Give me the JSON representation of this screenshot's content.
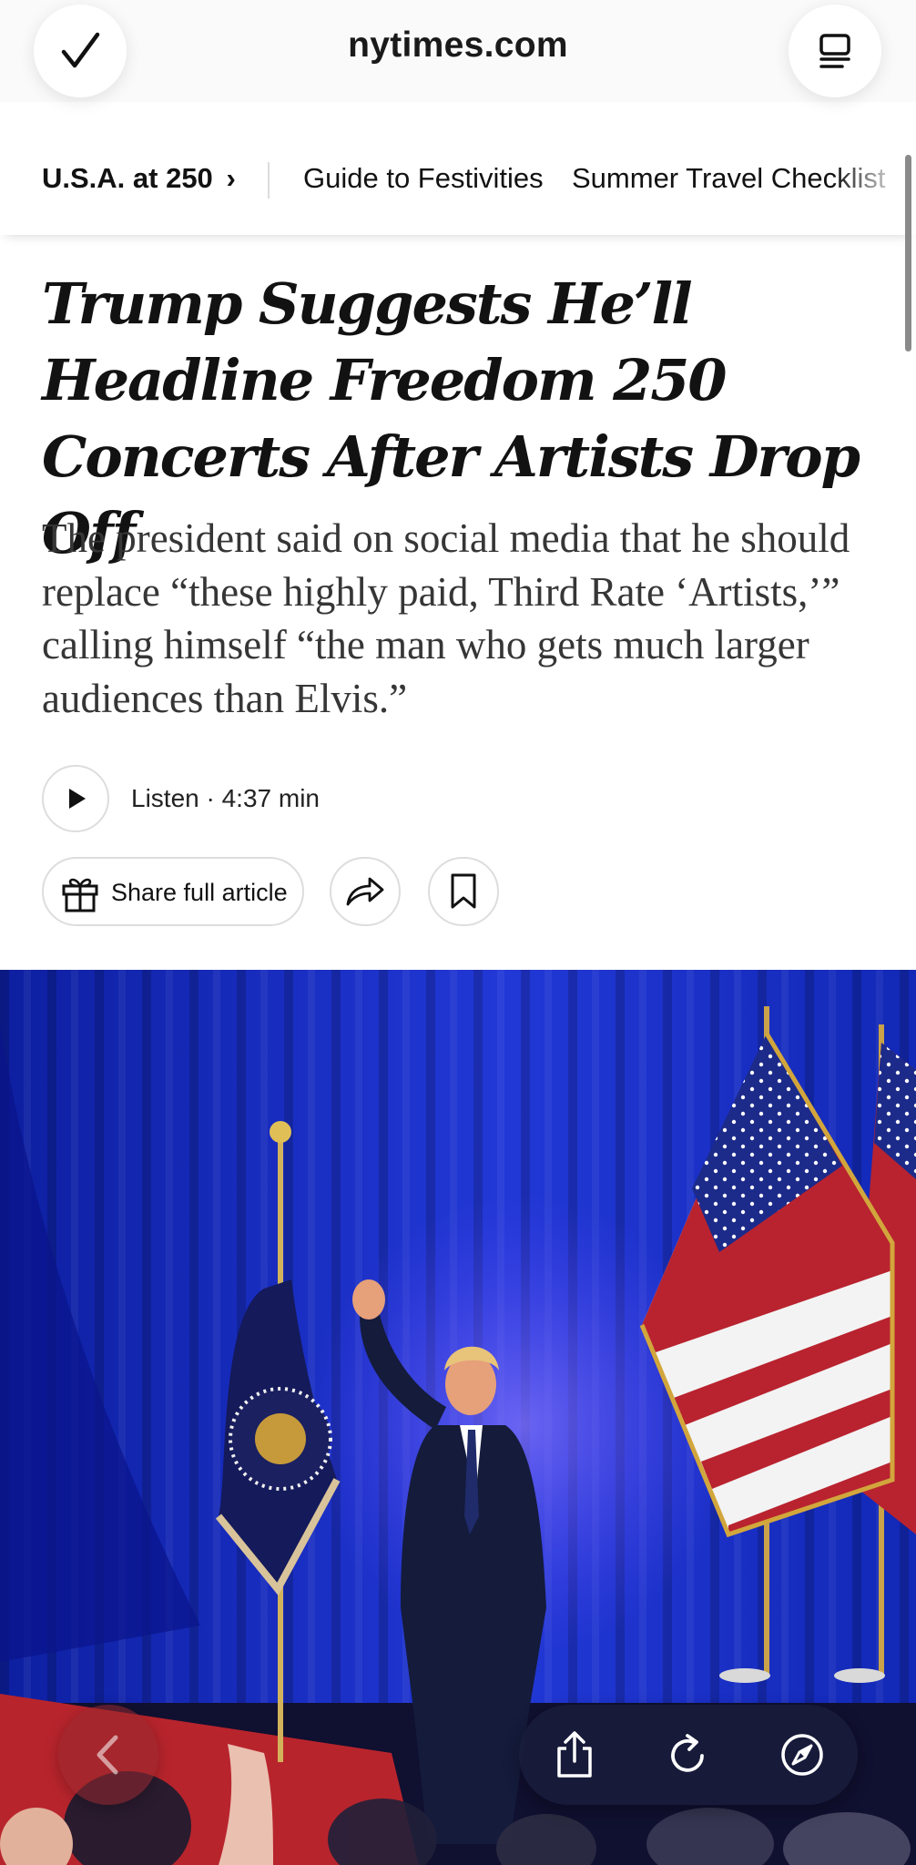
{
  "browser": {
    "url": "nytimes.com"
  },
  "section_nav": {
    "current": "U.S.A. at 250",
    "current_chevron": "›",
    "links": [
      "Guide to Festivities",
      "Summer Travel Checklist"
    ]
  },
  "article": {
    "headline": "Trump Suggests He’ll Headline Freedom 250 Concerts After Artists Drop Off",
    "summary": "The president said on social media that he should replace “these highly paid, Third Rate ‘Artists,’” calling himself “the man who gets much larger audiences than Elvis.”",
    "listen_label": "Listen · 4:37 min",
    "share_label": "Share full article"
  },
  "icons": {
    "done": "checkmark-icon",
    "reader": "reader-mode-icon",
    "play": "play-icon",
    "gift": "gift-icon",
    "share_arrow": "share-arrow-icon",
    "bookmark": "bookmark-icon",
    "back": "chevron-left-icon",
    "share_sheet": "share-sheet-icon",
    "reload": "reload-icon",
    "compass": "compass-icon"
  },
  "colors": {
    "curtain": "#1a2fc4",
    "carpet": "#b8242c",
    "text": "#121212",
    "summary": "#363636"
  }
}
